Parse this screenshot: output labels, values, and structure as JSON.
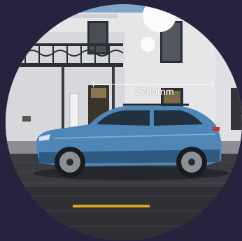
{
  "dimension": {
    "label": "2700mm"
  },
  "colors": {
    "background": "#26233f",
    "car_body": "#4f86b8",
    "accent_line": "#d9a624",
    "marker": "#fbfbfb"
  }
}
